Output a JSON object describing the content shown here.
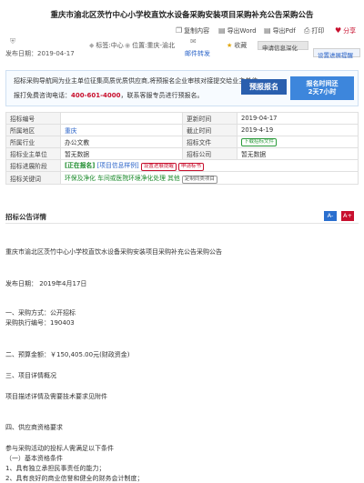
{
  "title": "重庆市渝北区茨竹中心小学校直饮水设备采购安装项目采购补充公告采购公告",
  "toolbar": {
    "copy": "复制内容",
    "export_word": "导出Word",
    "export_pdf": "导出Pdf",
    "print": "打印",
    "share": "分享"
  },
  "meta": {
    "publish_date": "发布日期：2019-04-17",
    "industry": "标签:中心",
    "location": "位置:重庆-渝北",
    "email": "邮件转发",
    "favorite": "收藏",
    "apply_info": "申请信息深化",
    "progress": "设置进展提醒"
  },
  "notice": {
    "line1": "招标采购导航网为业主单位征集高质优质供应商,将预报名企业审核对接提交给业主单位。",
    "line2_prefix": "报打免费咨询电话：",
    "phone": "400-601-4000",
    "line2_suffix": "，联系客服专员进行预报名。",
    "signup_button": "预报报名",
    "deadline_line1": "报名时间还",
    "deadline_line2": "2天7小时"
  },
  "info_table": {
    "rows": [
      {
        "l1": "招标编号",
        "v1": "",
        "l2": "更新时间",
        "v2": "2019-04-17"
      },
      {
        "l1": "所属地区",
        "v1": "重庆",
        "l2": "截止时间",
        "v2": "2019-4-19"
      },
      {
        "l1": "所属行业",
        "v1": "办公文教",
        "l2": "招标文件",
        "v2": "下载招标文件"
      },
      {
        "l1": "招标业主单位",
        "v1": "暂无数据",
        "l2": "招标公司",
        "v2": "暂无数据"
      }
    ],
    "stage_label": "招标进展阶段",
    "stage_value": "[正在报名]",
    "stage_link": "[项目信息样例]",
    "stage_tag1": "设置进展提醒",
    "stage_tag2": "申请标书",
    "keyword_label": "招标关键词",
    "keywords": "环保及净化 车间或医院环境净化处理 其他",
    "keyword_tag": "定制同类项目"
  },
  "detail": {
    "section_title": "招标公告详情",
    "font_small": "A-",
    "font_large": "A+",
    "heading": "重庆市渝北区茨竹中心小学校直饮水设备采购安装项目采购补充公告采购公告",
    "publish": "发布日期：  2019年4月17日",
    "p1_title": "一、采购方式：公开招标",
    "p1_code": "采购执行编号：190403",
    "p2": "二、预算金额：￥150,405.00元(财政资金)",
    "p3_title": "三、项目详情概况",
    "p3_body": "项目描述详情及需要技术要求见附件",
    "p4_title": "四、供应商资格要求",
    "p4_body": "参与采购活动的投标人需满足以下条件",
    "p4_sub": "（一）基本资格条件",
    "p4_i1": "1、具有独立承担民事责任的能力；",
    "p4_i2": "2、具有良好的商业信誉和健全的财务会计制度；"
  },
  "colors": {
    "accent_red": "#c8102e",
    "link_blue": "#2a63c8",
    "button_blue": "#2a6fcf",
    "keyword_green": "#1a8a2a"
  }
}
